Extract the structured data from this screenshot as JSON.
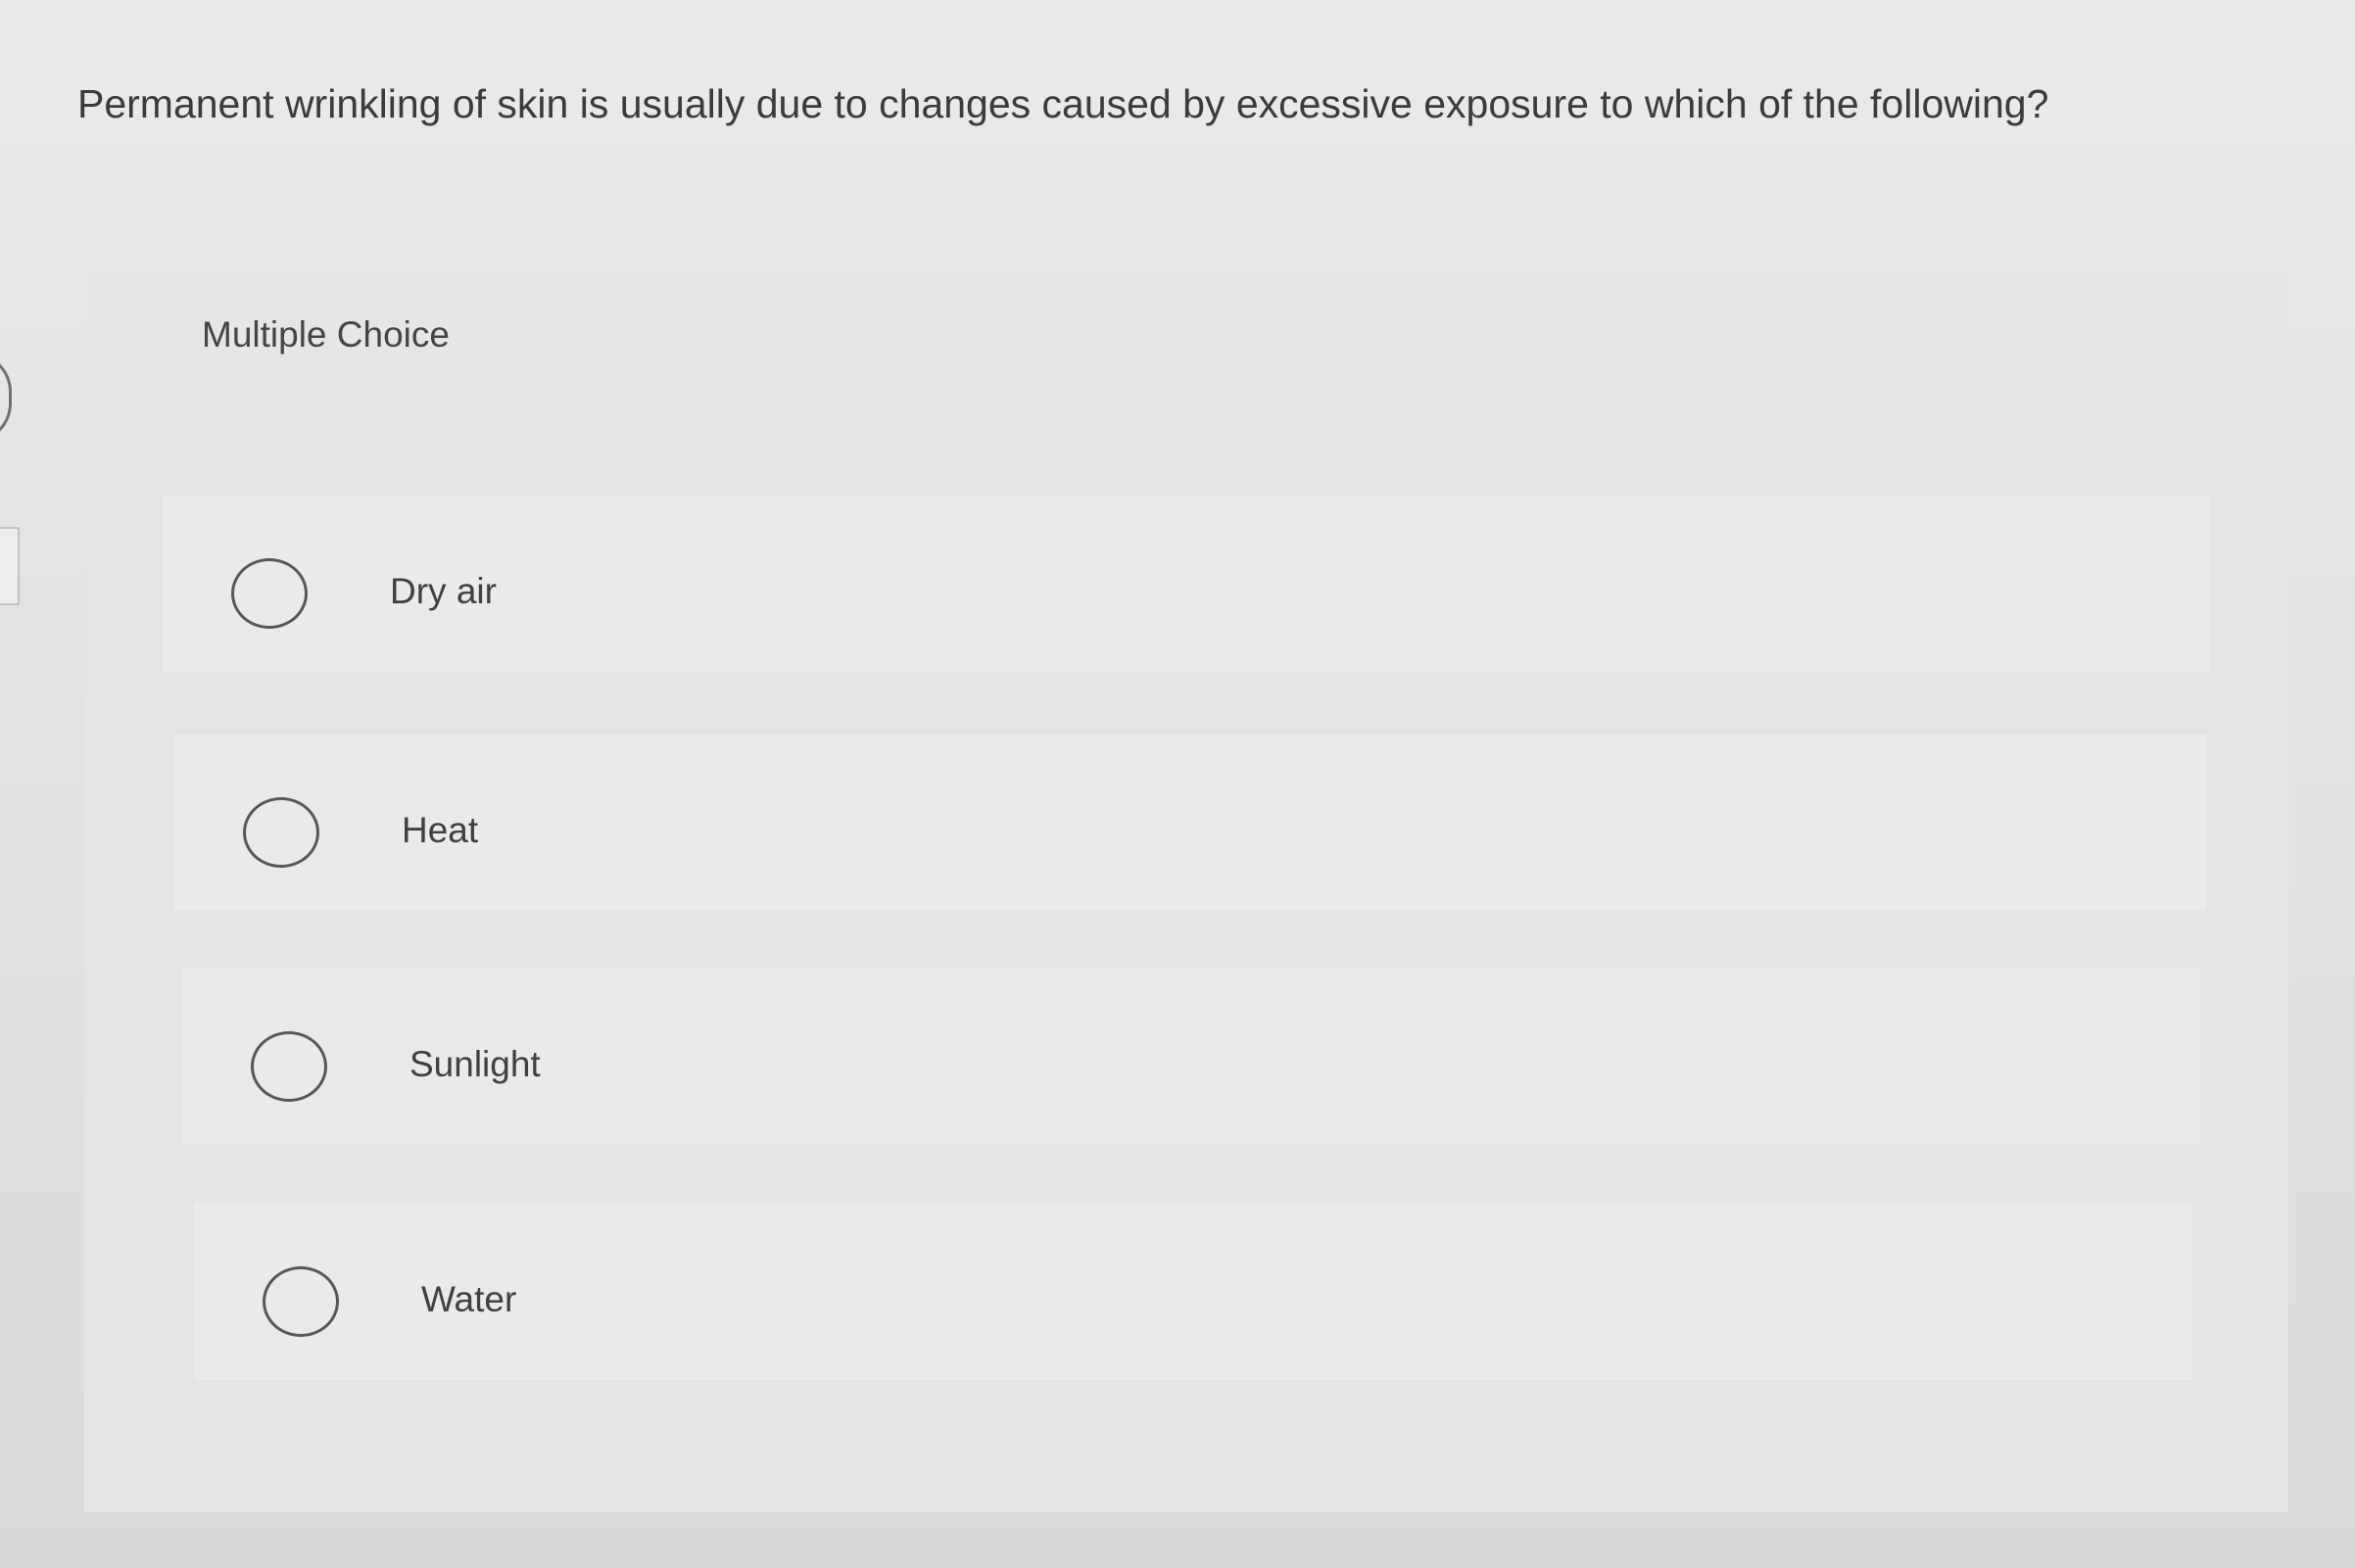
{
  "question": {
    "text": "Permanent wrinkling of skin is usually due to changes caused by excessive exposure to which of the following?"
  },
  "card": {
    "type_label": "Multiple Choice",
    "options": [
      {
        "label": "Dry air",
        "selected": false
      },
      {
        "label": "Heat",
        "selected": false
      },
      {
        "label": "Sunlight",
        "selected": false
      },
      {
        "label": "Water",
        "selected": false
      }
    ]
  }
}
